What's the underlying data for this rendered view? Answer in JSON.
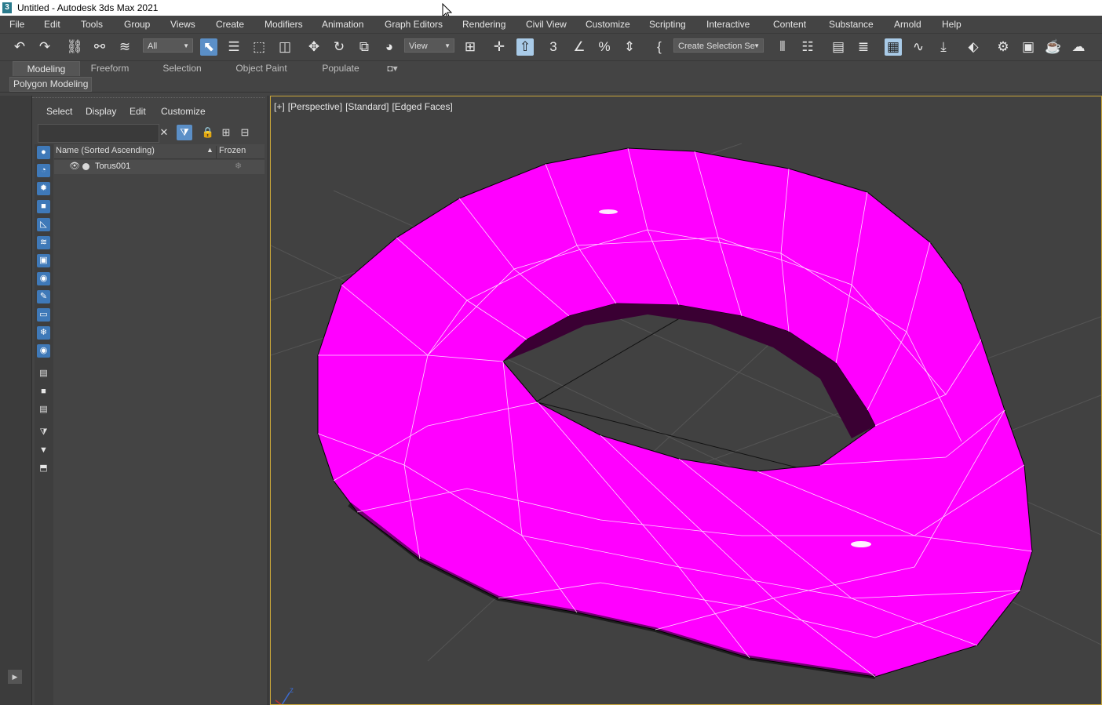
{
  "window": {
    "title": "Untitled - Autodesk 3ds Max 2021",
    "app_icon": "3"
  },
  "menu": [
    {
      "label": "File"
    },
    {
      "label": "Edit"
    },
    {
      "label": "Tools"
    },
    {
      "label": "Group"
    },
    {
      "label": "Views"
    },
    {
      "label": "Create"
    },
    {
      "label": "Modifiers"
    },
    {
      "label": "Animation"
    },
    {
      "label": "Graph Editors"
    },
    {
      "label": "Rendering"
    },
    {
      "label": "Civil View"
    },
    {
      "label": "Customize"
    },
    {
      "label": "Scripting"
    },
    {
      "label": "Interactive"
    },
    {
      "label": "Content"
    },
    {
      "label": "Substance"
    },
    {
      "label": "Arnold"
    },
    {
      "label": "Help"
    }
  ],
  "toolbar": {
    "selection_filter": "All",
    "ref_coord": "View",
    "named_selection": "Create Selection Se"
  },
  "ribbon": {
    "tabs": [
      "Modeling",
      "Freeform",
      "Selection",
      "Object Paint",
      "Populate"
    ],
    "active_tab": "Modeling",
    "panel_label": "Polygon Modeling"
  },
  "scene_explorer": {
    "menu": [
      "Select",
      "Display",
      "Edit",
      "Customize"
    ],
    "search_placeholder": "",
    "columns": {
      "name": "Name (Sorted Ascending)",
      "sort": "▲",
      "frozen": "Frozen"
    },
    "rows": [
      {
        "name": "Torus001"
      }
    ]
  },
  "viewport": {
    "labels": [
      "[+]",
      "[Perspective]",
      "[Standard]",
      "[Edged Faces]"
    ],
    "object_color": "#ff00ff",
    "axis_z": "z"
  }
}
